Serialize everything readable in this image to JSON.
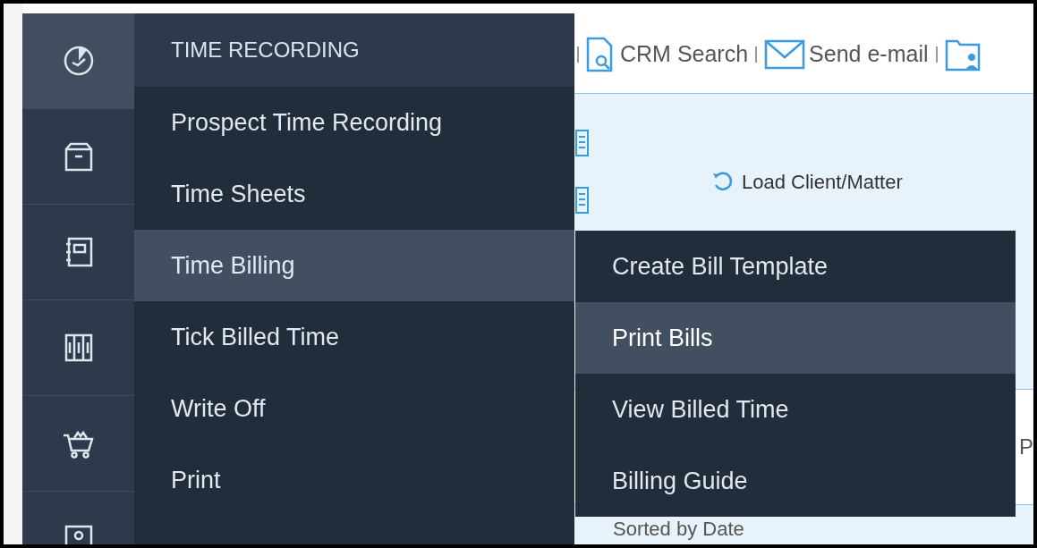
{
  "toolbar": {
    "items": [
      {
        "label": "CRM Search"
      },
      {
        "label": "Send e-mail"
      }
    ]
  },
  "panel": {
    "load_button": "Load Client/Matter",
    "sort_label": "Sorted by Date",
    "column_1": "P"
  },
  "sidebar": {
    "items": [
      {
        "selected": true
      },
      {
        "selected": false
      },
      {
        "selected": false
      },
      {
        "selected": false
      },
      {
        "selected": false
      },
      {
        "selected": false
      }
    ]
  },
  "menu": {
    "title": "TIME RECORDING",
    "items": [
      {
        "label": "Prospect Time Recording",
        "selected": false
      },
      {
        "label": "Time Sheets",
        "selected": false
      },
      {
        "label": "Time Billing",
        "selected": true
      },
      {
        "label": "Tick Billed Time",
        "selected": false
      },
      {
        "label": "Write Off",
        "selected": false
      },
      {
        "label": "Print",
        "selected": false
      }
    ]
  },
  "submenu": {
    "items": [
      {
        "label": "Create Bill Template",
        "selected": false
      },
      {
        "label": "Print Bills",
        "selected": true
      },
      {
        "label": "View Billed Time",
        "selected": false
      },
      {
        "label": "Billing Guide",
        "selected": false
      }
    ]
  }
}
